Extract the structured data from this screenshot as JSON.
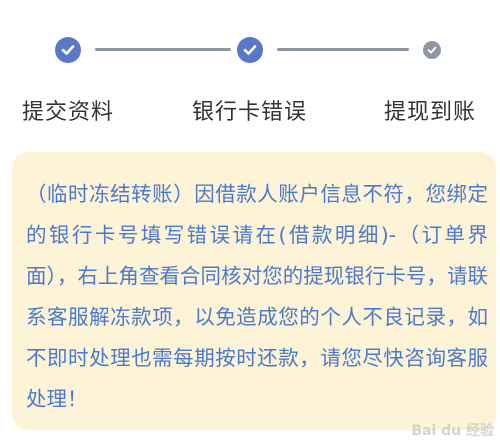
{
  "steps": [
    {
      "label": "提交资料",
      "state": "completed",
      "icon": "check-icon"
    },
    {
      "label": "银行卡错误",
      "state": "completed",
      "icon": "check-icon"
    },
    {
      "label": "提现到账",
      "state": "pending",
      "icon": "check-icon"
    }
  ],
  "notice": {
    "text": "（临时冻结转账）因借款人账户信息不符，您绑定的银行卡号填写错误请在(借款明细)-（订单界面），右上角查看合同核对您的提现银行卡号，请联系客服解冻款项，以免造成您的个人不良记录，如不即时处理也需每期按时还款，请您尽快咨询客服处理！"
  },
  "watermark": "Bai du 经验",
  "colors": {
    "accent_blue": "#5a78c8",
    "pending_gray": "#8f96a3",
    "notice_bg": "#fdf3d6",
    "notice_text": "#4a7ad0"
  }
}
